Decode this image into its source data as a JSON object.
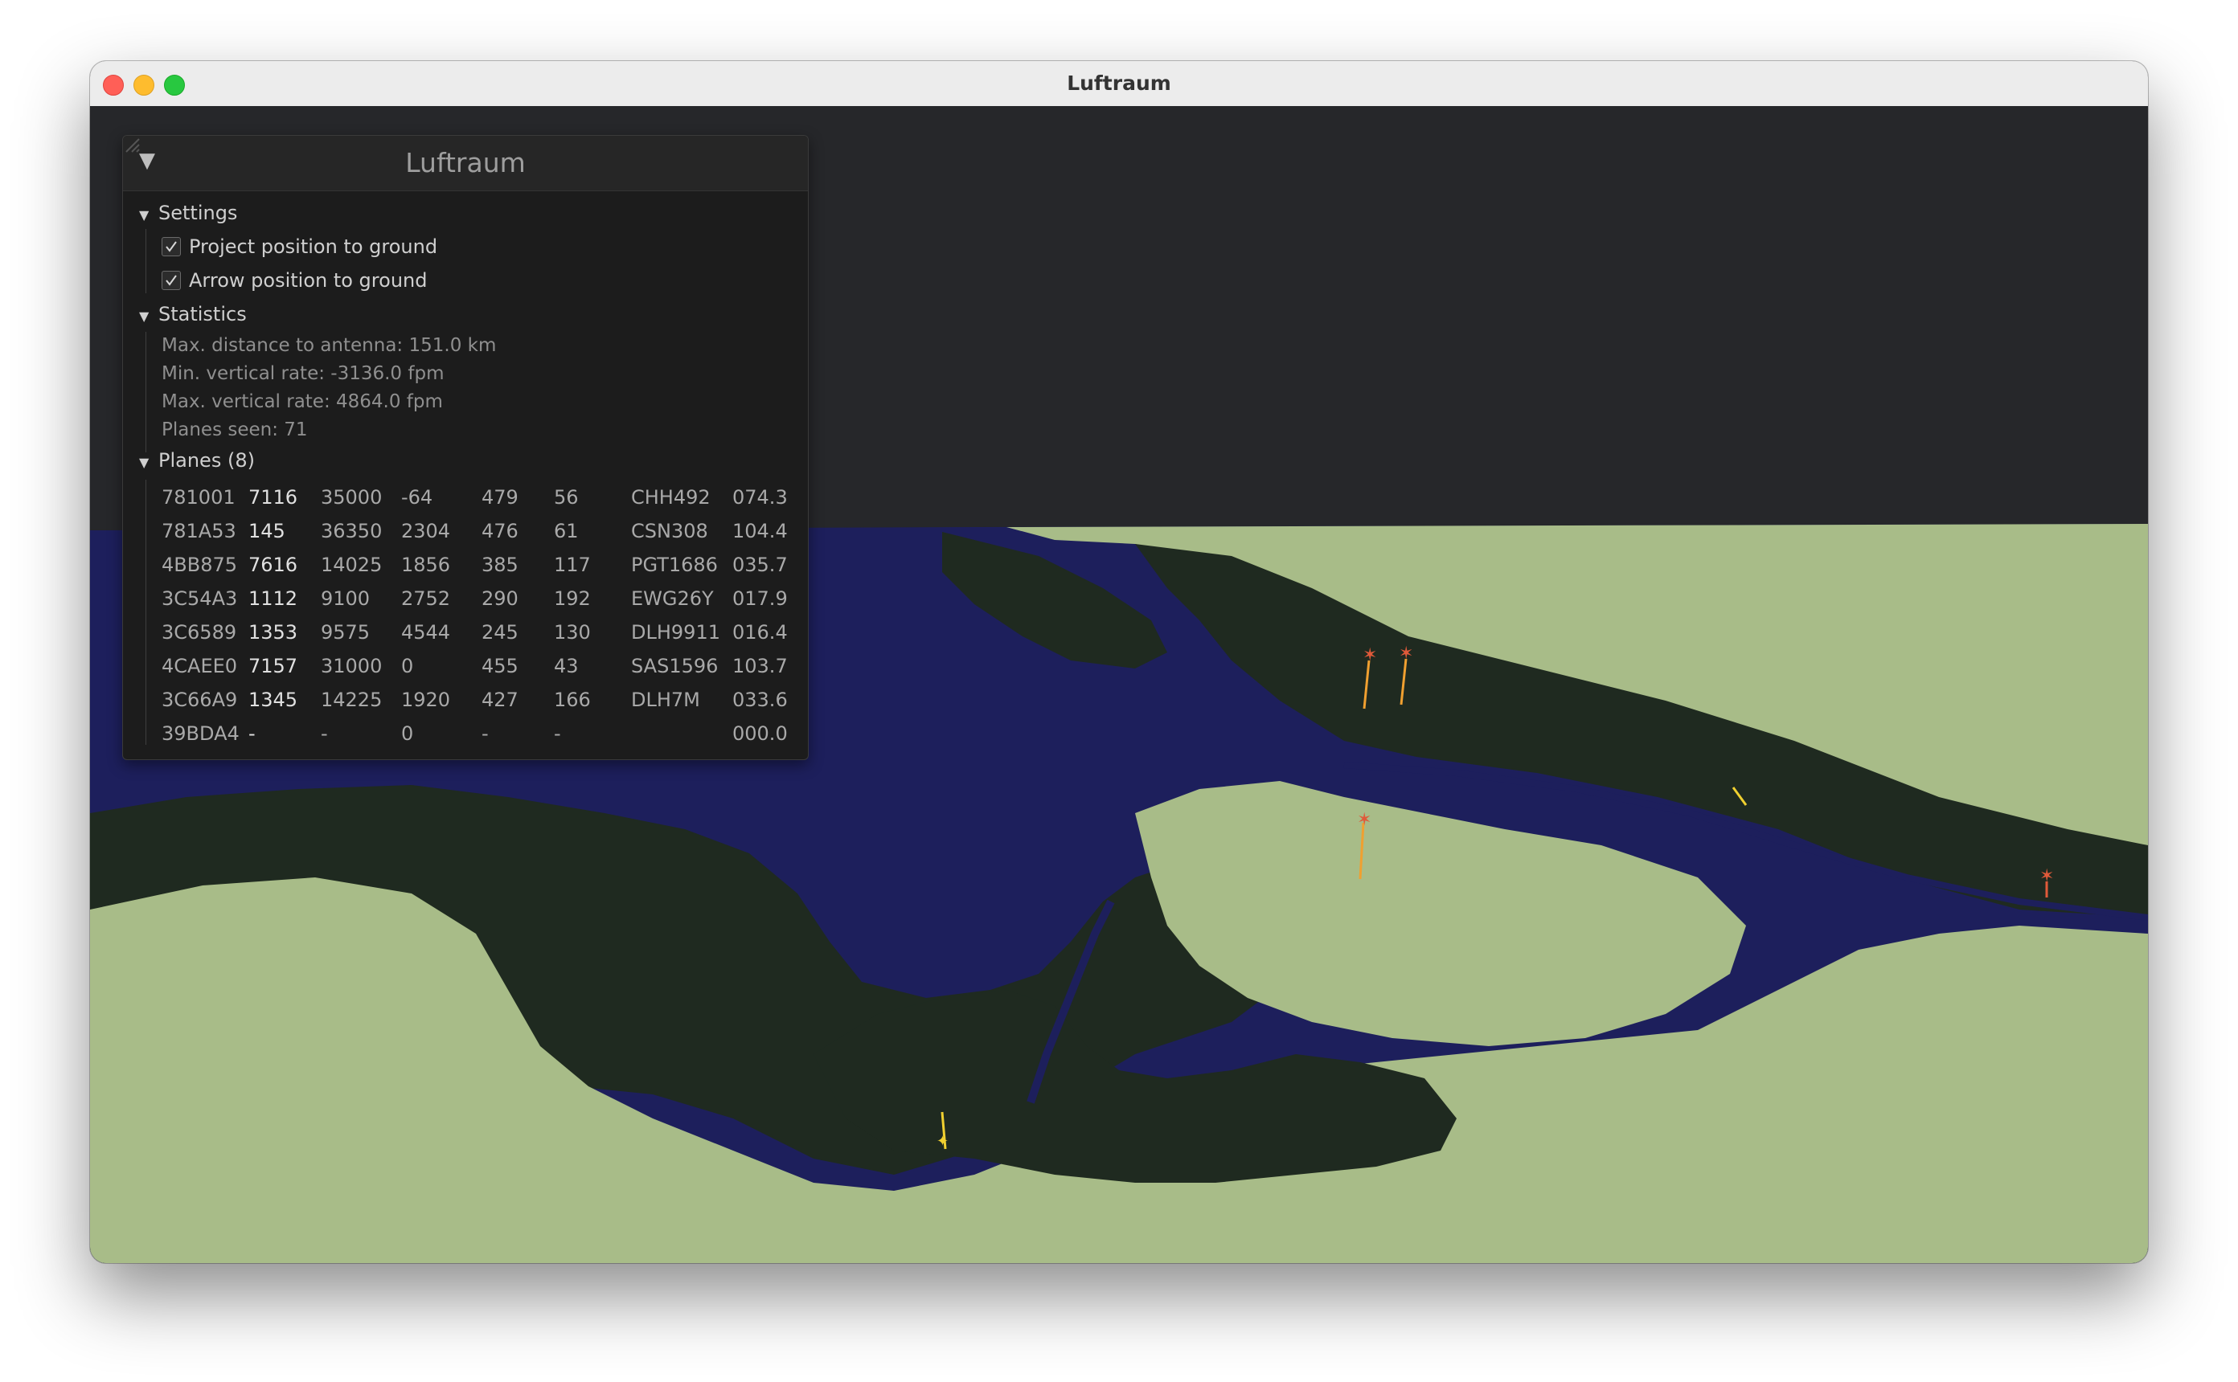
{
  "window": {
    "title": "Luftraum"
  },
  "panel": {
    "title": "Luftraum",
    "settings": {
      "label": "Settings",
      "options": [
        {
          "label": "Project position to ground",
          "checked": true
        },
        {
          "label": "Arrow position to ground",
          "checked": true
        }
      ]
    },
    "statistics": {
      "label": "Statistics",
      "lines": [
        "Max. distance to antenna: 151.0 km",
        "Min. vertical rate: -3136.0 fpm",
        "Max. vertical rate: 4864.0 fpm",
        "Planes seen: 71"
      ]
    },
    "planes": {
      "label": "Planes (8)",
      "rows": [
        [
          "781001",
          "7116",
          "35000",
          "-64",
          "479",
          "56",
          "CHH492",
          "074.3"
        ],
        [
          "781A53",
          "145",
          "36350",
          "2304",
          "476",
          "61",
          "CSN308",
          "104.4"
        ],
        [
          "4BB875",
          "7616",
          "14025",
          "1856",
          "385",
          "117",
          "PGT1686",
          "035.7"
        ],
        [
          "3C54A3",
          "1112",
          "9100",
          "2752",
          "290",
          "192",
          "EWG26Y",
          "017.9"
        ],
        [
          "3C6589",
          "1353",
          "9575",
          "4544",
          "245",
          "130",
          "DLH9911",
          "016.4"
        ],
        [
          "4CAEE0",
          "7157",
          "31000",
          "0",
          "455",
          "43",
          "SAS1596",
          "103.7"
        ],
        [
          "3C66A9",
          "1345",
          "14225",
          "1920",
          "427",
          "166",
          "DLH7M",
          "033.6"
        ],
        [
          "39BDA4",
          "-",
          "-",
          "0",
          "-",
          "-",
          "",
          "000.0"
        ]
      ]
    }
  },
  "colors": {
    "sky": "#26272a",
    "water": "#1d1f5c",
    "land": "#a8bc88",
    "lowland": "#1f2a20",
    "marker_orange": "#f0a030",
    "marker_red": "#e05a3a"
  }
}
